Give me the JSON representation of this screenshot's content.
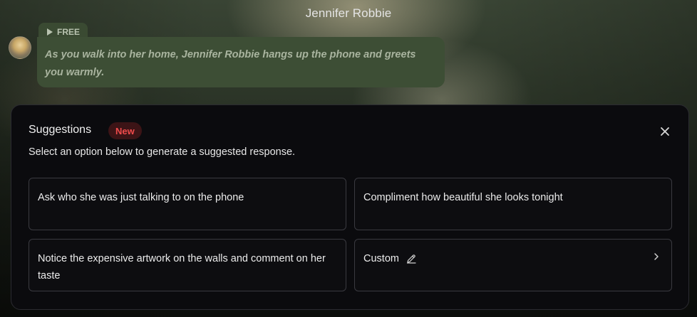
{
  "character": {
    "name": "Jennifer Robbie"
  },
  "message": {
    "badge_label": "FREE",
    "text": "As you walk into her home, Jennifer Robbie hangs up the phone and greets you warmly."
  },
  "suggestions": {
    "title": "Suggestions",
    "new_badge": "New",
    "subtitle": "Select an option below to generate a suggested response.",
    "options": [
      {
        "label": "Ask who she was just talking to on the phone"
      },
      {
        "label": "Compliment how beautiful she looks tonight"
      },
      {
        "label": "Notice the expensive artwork on the walls and comment on her taste"
      },
      {
        "label": "Custom"
      }
    ]
  },
  "icons": {
    "close": "close-icon",
    "play": "play-icon",
    "pencil": "pencil-icon",
    "chevron": "chevron-right-icon"
  },
  "colors": {
    "panel_bg": "#0b0b0e",
    "bubble_bg": "#3d4e35",
    "new_badge_text": "#ef4b4b",
    "new_badge_bg": "#3c1416"
  }
}
